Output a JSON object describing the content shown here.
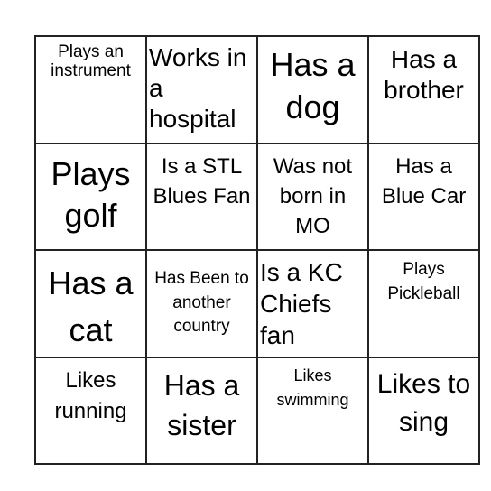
{
  "board": {
    "rows": [
      [
        "Plays an instrument",
        "Works in a hospital",
        "Has a dog",
        "Has a brother"
      ],
      [
        "Plays golf",
        "Is a STL Blues Fan",
        "Was not born in MO",
        "Has a Blue Car"
      ],
      [
        "Has a cat",
        "Has Been to another country",
        "Is a KC Chiefs fan",
        "Plays Pickleball"
      ],
      [
        "Likes running",
        "Has a sister",
        "Likes swimming",
        "Likes to sing"
      ]
    ]
  }
}
